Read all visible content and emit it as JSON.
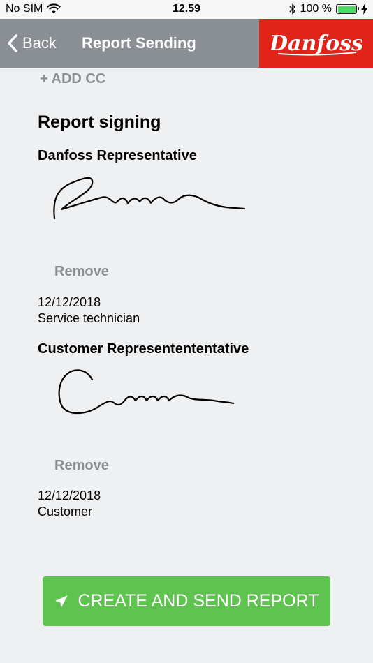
{
  "status_bar": {
    "carrier": "No SIM",
    "time": "12.59",
    "battery_text": "100 %",
    "battery_level": 1.0
  },
  "nav": {
    "back_label": "Back",
    "title": "Report Sending",
    "brand": "Danfoss"
  },
  "add_cc_label": "+ ADD CC",
  "report_signing": {
    "title": "Report signing",
    "danfoss": {
      "heading": "Danfoss Representative",
      "remove_label": "Remove",
      "date": "12/12/2018",
      "role": "Service technician"
    },
    "customer": {
      "heading": "Customer Representententative",
      "remove_label": "Remove",
      "date": "12/12/2018",
      "role": "Customer"
    }
  },
  "primary_action": {
    "label": "CREATE AND SEND REPORT",
    "color": "#5ec34f"
  },
  "colors": {
    "nav_bg": "#8a8f95",
    "brand_red": "#e2231a",
    "muted": "#8a8f95"
  }
}
